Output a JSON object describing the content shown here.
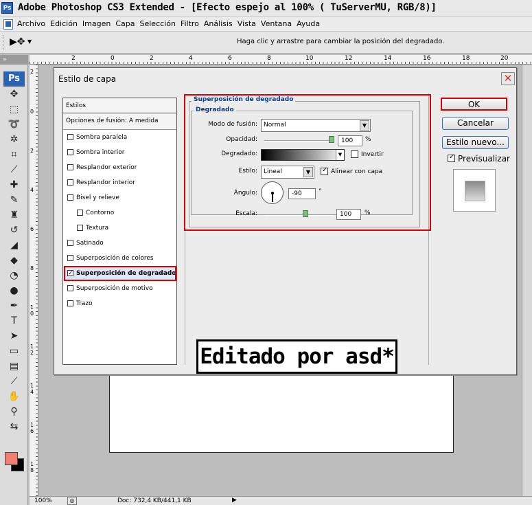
{
  "window": {
    "title": "Adobe Photoshop CS3 Extended - [Efecto espejo al 100% (           TuServerMU, RGB/8)]"
  },
  "menu": [
    "Archivo",
    "Edición",
    "Imagen",
    "Capa",
    "Selección",
    "Filtro",
    "Análisis",
    "Vista",
    "Ventana",
    "Ayuda"
  ],
  "options_bar": {
    "hint": "Haga clic y arrastre para cambiar la posición del degradado."
  },
  "ruler_h": [
    "2",
    "0",
    "2",
    "4",
    "6",
    "8",
    "10",
    "12",
    "14",
    "16",
    "18",
    "20"
  ],
  "ruler_v": [
    "2",
    "0",
    "2",
    "4",
    "6",
    "8",
    "1 0",
    "1 2",
    "1 4",
    "1 6",
    "1 8"
  ],
  "status": {
    "zoom": "100%",
    "doc": "Doc: 732,4 KB/441,1 KB"
  },
  "dialog": {
    "title": "Estilo de capa",
    "styles_header": "Estilos",
    "blend_options": "Opciones de fusión: A medida",
    "styles": [
      {
        "label": "Sombra paralela",
        "checked": false
      },
      {
        "label": "Sombra interior",
        "checked": false
      },
      {
        "label": "Resplandor exterior",
        "checked": false
      },
      {
        "label": "Resplandor interior",
        "checked": false
      },
      {
        "label": "Bisel y relieve",
        "checked": false
      },
      {
        "label": "Contorno",
        "checked": false
      },
      {
        "label": "Textura",
        "checked": false
      },
      {
        "label": "Satinado",
        "checked": false
      },
      {
        "label": "Superposición de colores",
        "checked": false
      },
      {
        "label": "Superposición de degradado",
        "checked": true
      },
      {
        "label": "Superposición de motivo",
        "checked": false
      },
      {
        "label": "Trazo",
        "checked": false
      }
    ],
    "section_title": "Superposición de degradado",
    "subsection_title": "Degradado",
    "blend_mode_label": "Modo de fusión:",
    "blend_mode_value": "Normal",
    "opacity_label": "Opacidad:",
    "opacity_value": "100",
    "gradient_label": "Degradado:",
    "invert_label": "Invertir",
    "style_label": "Estilo:",
    "style_value": "Lineal",
    "align_label": "Alinear con capa",
    "angle_label": "Ángulo:",
    "angle_value": "-90",
    "angle_unit": "°",
    "scale_label": "Escala:",
    "scale_value": "100",
    "percent": "%",
    "buttons": {
      "ok": "OK",
      "cancel": "Cancelar",
      "new_style": "Estilo nuevo...",
      "preview": "Previsualizar"
    }
  },
  "watermark": "Editado por asd*"
}
